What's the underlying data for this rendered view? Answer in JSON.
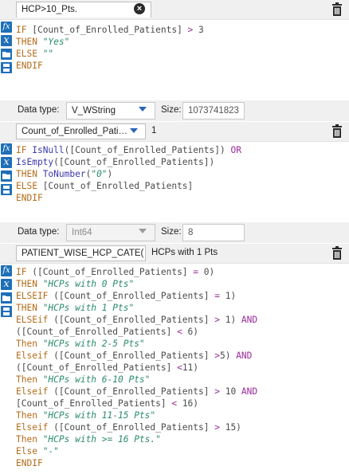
{
  "blocks": [
    {
      "output_field": "HCP>10_Pts.",
      "source_value": "",
      "data_type_label": "Data type:",
      "data_type": "V_WString",
      "size_label": "Size:",
      "size": "1073741823"
    },
    {
      "output_field": "Count_of_Enrolled_Pati…",
      "source_value": "1",
      "data_type_label": "Data type:",
      "data_type": "Int64",
      "size_label": "Size:",
      "size": "8"
    },
    {
      "output_field": "PATIENT_WISE_HCP_CATE(",
      "source_value": "HCPs with 1 Pts",
      "data_type_label": "",
      "data_type": "",
      "size_label": "",
      "size": ""
    }
  ],
  "icons": {
    "formula": "fx",
    "variable": "x",
    "folder": "folder-icon",
    "save": "save-icon",
    "clear": "close-icon",
    "delete": "trash-icon",
    "dropdown": "chevron-down-icon"
  },
  "code1": [
    [
      [
        "kw",
        "IF "
      ],
      [
        "fld",
        "[Count_of_Enrolled_Patients]"
      ],
      [
        "op",
        " > "
      ],
      [
        "num",
        "3"
      ]
    ],
    [
      [
        "kw",
        "THEN "
      ],
      [
        "str",
        "\"Yes\""
      ]
    ],
    [
      [
        "kw",
        "ELSE "
      ],
      [
        "str",
        "\"\""
      ]
    ],
    [
      [
        "kw",
        "ENDIF"
      ]
    ]
  ],
  "code2": [
    [
      [
        "kw",
        "IF "
      ],
      [
        "fn",
        "IsNull"
      ],
      [
        "fld",
        "([Count_of_Enrolled_Patients])"
      ],
      [
        "op",
        " OR"
      ]
    ],
    [
      [
        "fn",
        "IsEmpty"
      ],
      [
        "fld",
        "([Count_of_Enrolled_Patients])"
      ]
    ],
    [
      [
        "kw",
        "THEN "
      ],
      [
        "fn",
        "ToNumber"
      ],
      [
        "fld",
        "("
      ],
      [
        "str",
        "\"0\""
      ],
      [
        "fld",
        ")"
      ]
    ],
    [
      [
        "kw",
        "ELSE "
      ],
      [
        "fld",
        "[Count_of_Enrolled_Patients]"
      ]
    ],
    [
      [
        "kw",
        "ENDIF"
      ]
    ]
  ],
  "code3": [
    [
      [
        "kw",
        "IF "
      ],
      [
        "fld",
        "([Count_of_Enrolled_Patients]"
      ],
      [
        "op",
        " = "
      ],
      [
        "num",
        "0)"
      ]
    ],
    [
      [
        "kw",
        "THEN "
      ],
      [
        "str",
        "\"HCPs with 0 Pts\""
      ]
    ],
    [
      [
        "kw",
        "ELSEIF "
      ],
      [
        "fld",
        "([Count_of_Enrolled_Patients]"
      ],
      [
        "op",
        " = "
      ],
      [
        "num",
        "1)"
      ]
    ],
    [
      [
        "kw",
        "THEN "
      ],
      [
        "str",
        "\"HCPs with 1 Pts\""
      ]
    ],
    [
      [
        "kw",
        "ELSEif "
      ],
      [
        "fld",
        "([Count_of_Enrolled_Patients]"
      ],
      [
        "op",
        " > "
      ],
      [
        "num",
        "1) "
      ],
      [
        "op",
        "AND"
      ]
    ],
    [
      [
        "fld",
        "([Count_of_Enrolled_Patients]"
      ],
      [
        "op",
        " < "
      ],
      [
        "num",
        "6)"
      ]
    ],
    [
      [
        "kw",
        "Then "
      ],
      [
        "str",
        "\"HCPs with 2-5 Pts\""
      ]
    ],
    [
      [
        "kw",
        "Elseif "
      ],
      [
        "fld",
        "([Count_of_Enrolled_Patients]"
      ],
      [
        "op",
        " >"
      ],
      [
        "num",
        "5) "
      ],
      [
        "op",
        "AND"
      ]
    ],
    [
      [
        "fld",
        "([Count_of_Enrolled_Patients]"
      ],
      [
        "op",
        " <"
      ],
      [
        "num",
        "11)"
      ]
    ],
    [
      [
        "kw",
        "Then "
      ],
      [
        "str",
        "\"HCPs with 6-10 Pts\""
      ]
    ],
    [
      [
        "kw",
        "Elseif "
      ],
      [
        "fld",
        "([Count_of_Enrolled_Patients]"
      ],
      [
        "op",
        " > "
      ],
      [
        "num",
        "10 "
      ],
      [
        "op",
        "AND"
      ]
    ],
    [
      [
        "fld",
        "[Count_of_Enrolled_Patients]"
      ],
      [
        "op",
        " < "
      ],
      [
        "num",
        "16)"
      ]
    ],
    [
      [
        "kw",
        "Then "
      ],
      [
        "str",
        "\"HCPs with 11-15 Pts\""
      ]
    ],
    [
      [
        "kw",
        "Elseif "
      ],
      [
        "fld",
        "([Count_of_Enrolled_Patients]"
      ],
      [
        "op",
        " > "
      ],
      [
        "num",
        "15)"
      ]
    ],
    [
      [
        "kw",
        "Then "
      ],
      [
        "str",
        "\"HCPs with >= 16 Pts.\""
      ]
    ],
    [
      [
        "kw",
        "Else "
      ],
      [
        "str",
        "\"-\""
      ]
    ],
    [
      [
        "kw",
        "ENDIF"
      ]
    ]
  ]
}
